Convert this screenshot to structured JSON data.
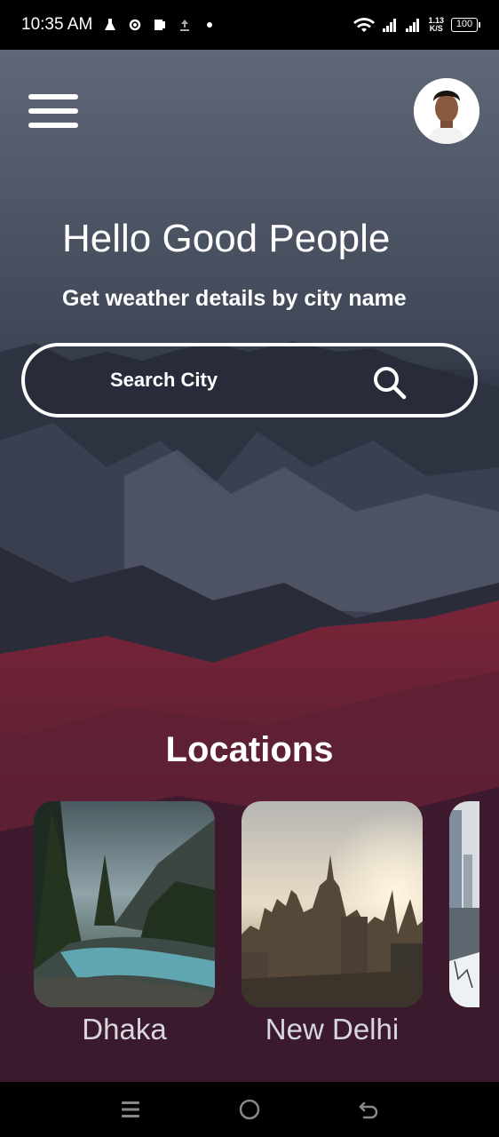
{
  "status_bar": {
    "time": "10:35 AM",
    "netspeed_value": "1.13",
    "netspeed_unit": "K/S",
    "battery": "100"
  },
  "header": {
    "greeting": "Hello Good People",
    "subtitle": "Get weather details by city name"
  },
  "search": {
    "placeholder": "Search City",
    "value": ""
  },
  "locations": {
    "title": "Locations",
    "items": [
      {
        "name": "Dhaka"
      },
      {
        "name": "New Delhi"
      }
    ]
  },
  "colors": {
    "text": "#ffffff",
    "card_label": "#d6d6dc",
    "bar_background": "#000000"
  },
  "icons": {
    "menu": "hamburger-menu-icon",
    "search": "search-icon",
    "nav_recent": "recent-apps-icon",
    "nav_home": "home-icon",
    "nav_back": "back-icon"
  }
}
